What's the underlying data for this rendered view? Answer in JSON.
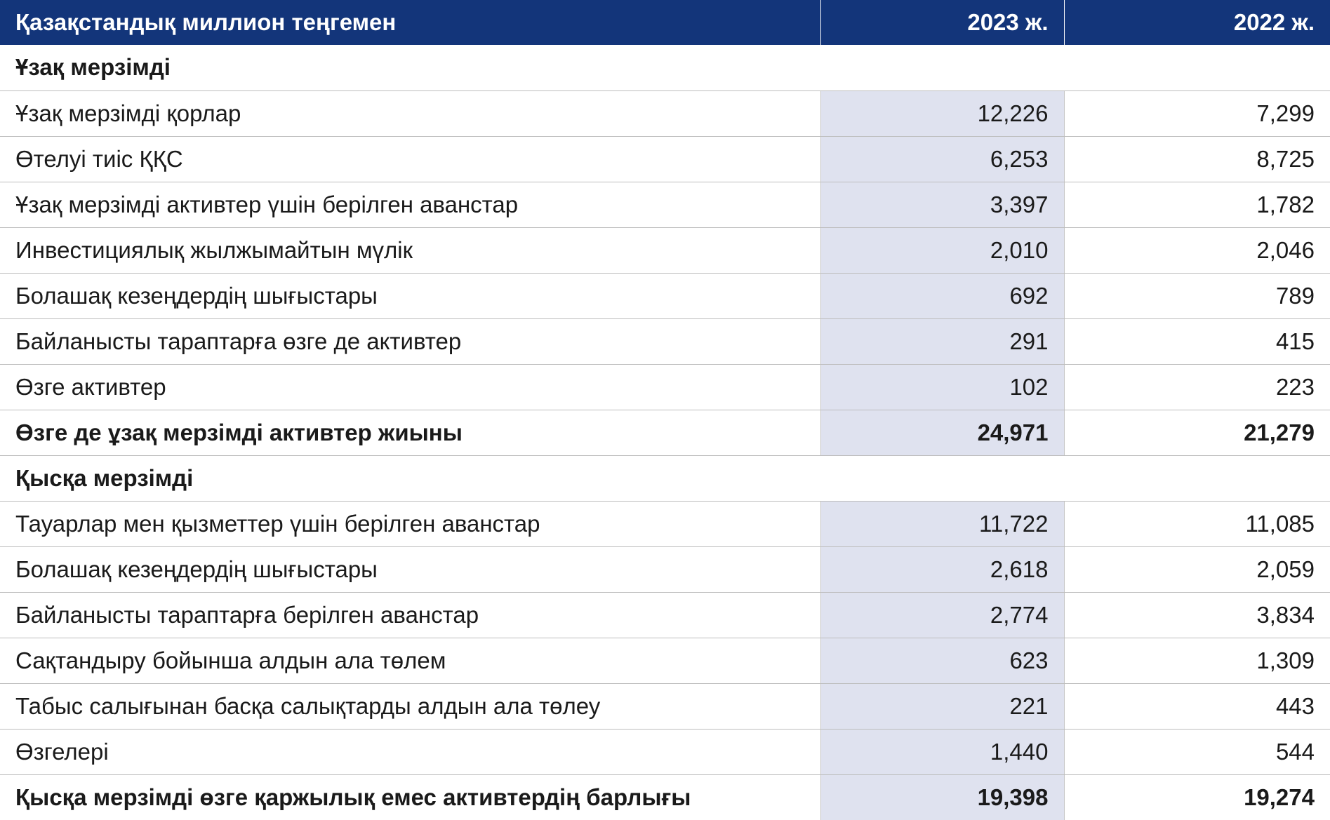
{
  "header": {
    "label": "Қазақстандық миллион теңгемен",
    "col_2023": "2023 ж.",
    "col_2022": "2022 ж."
  },
  "long_term": {
    "title": "Ұзақ мерзімді",
    "rows": [
      {
        "label": "Ұзақ мерзімді қорлар",
        "v2023": "12,226",
        "v2022": "7,299"
      },
      {
        "label": "Өтелуі тиіс ҚҚС",
        "v2023": "6,253",
        "v2022": "8,725"
      },
      {
        "label": "Ұзақ мерзімді активтер үшін берілген аванстар",
        "v2023": "3,397",
        "v2022": "1,782"
      },
      {
        "label": "Инвестициялық жылжымайтын мүлік",
        "v2023": "2,010",
        "v2022": "2,046"
      },
      {
        "label": "Болашақ кезеңдердің шығыстары",
        "v2023": "692",
        "v2022": "789"
      },
      {
        "label": "Байланысты тараптарға өзге де активтер",
        "v2023": "291",
        "v2022": "415"
      },
      {
        "label": "Өзге активтер",
        "v2023": "102",
        "v2022": "223"
      }
    ],
    "total": {
      "label": "Өзге де ұзақ мерзімді активтер жиыны",
      "v2023": "24,971",
      "v2022": "21,279"
    }
  },
  "short_term": {
    "title": "Қысқа мерзімді",
    "rows": [
      {
        "label": "Тауарлар мен қызметтер үшін берілген аванстар",
        "v2023": "11,722",
        "v2022": "11,085"
      },
      {
        "label": "Болашақ кезеңдердің шығыстары",
        "v2023": "2,618",
        "v2022": "2,059"
      },
      {
        "label": "Байланысты тараптарға берілген аванстар",
        "v2023": "2,774",
        "v2022": "3,834"
      },
      {
        "label": "Сақтандыру бойынша алдын ала төлем",
        "v2023": "623",
        "v2022": "1,309"
      },
      {
        "label": "Табыс салығынан басқа салықтарды алдын ала төлеу",
        "v2023": "221",
        "v2022": "443"
      },
      {
        "label": "Өзгелері",
        "v2023": "1,440",
        "v2022": "544"
      }
    ],
    "total": {
      "label": "Қысқа мерзімді өзге қаржылық емес активтердің барлығы",
      "v2023": "19,398",
      "v2022": "19,274"
    }
  },
  "colors": {
    "header_bg": "#13357a",
    "highlight_col": "#dfe2ef"
  }
}
